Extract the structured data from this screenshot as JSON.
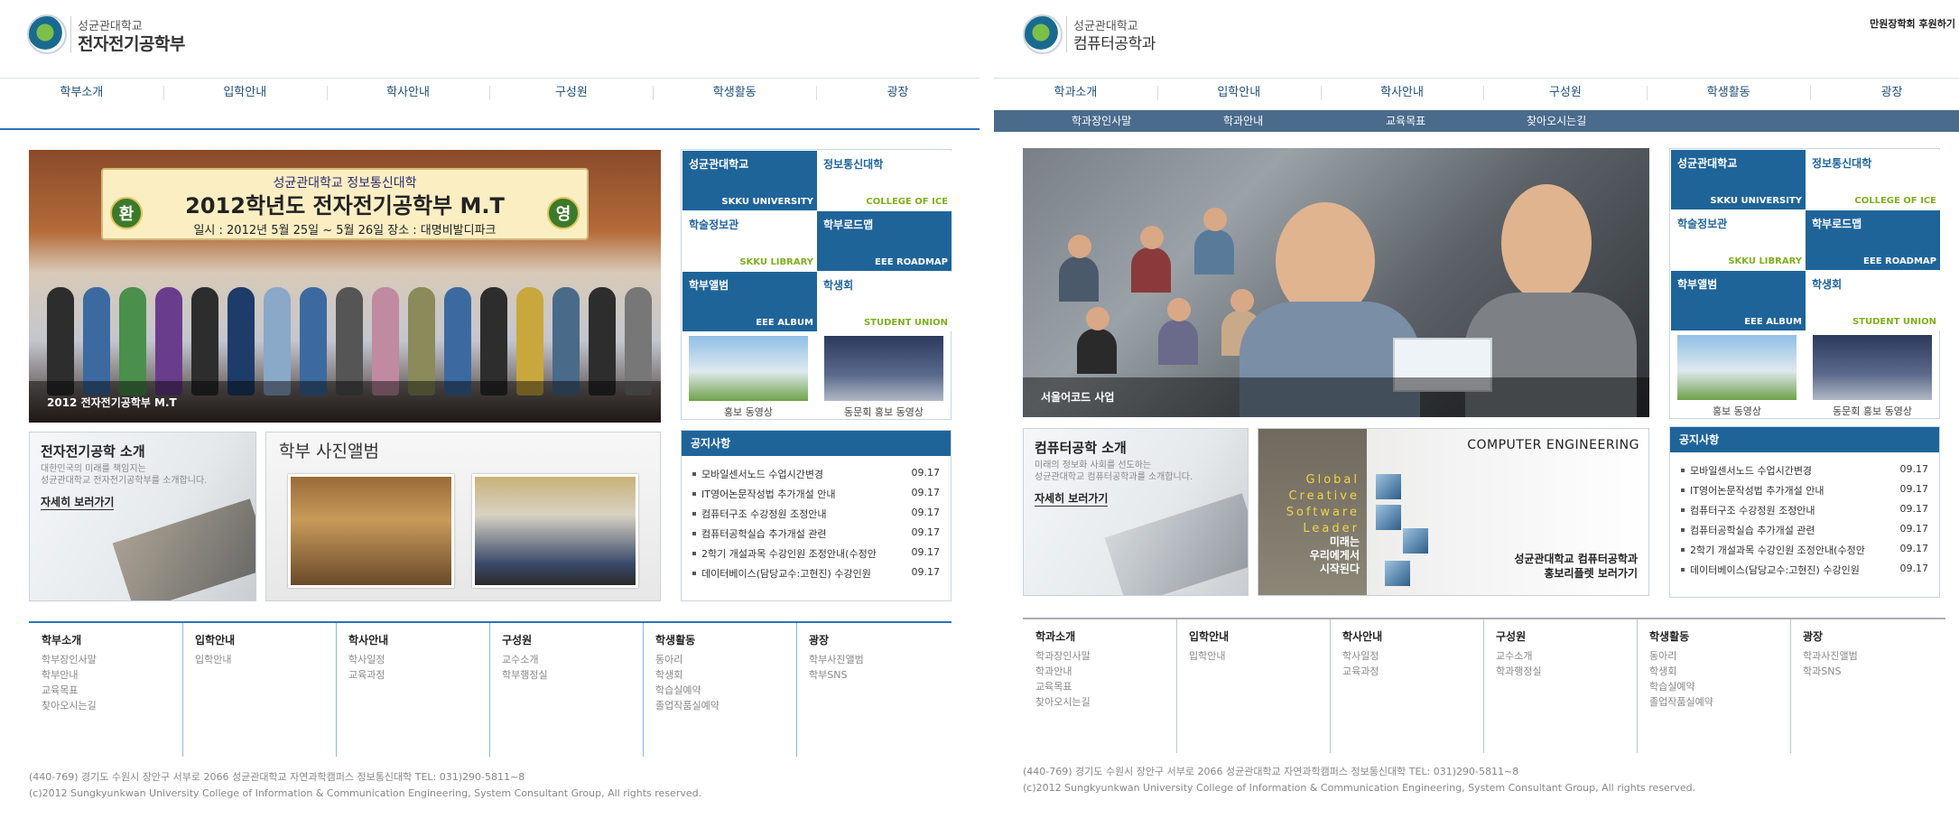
{
  "left": {
    "univ": "성균관대학교",
    "dept": "전자전기공학부",
    "gnb": [
      "학부소개",
      "입학안내",
      "학사안내",
      "구성원",
      "학생활동",
      "광장"
    ],
    "hero": {
      "banner_top": "성균관대학교  정보통신대학",
      "banner_circle_left": "환",
      "banner_main": "2012학년도 전자전기공학부 M.T",
      "banner_circle_right": "영",
      "banner_sub": "일시 : 2012년 5월 25일 ~ 5월 26일    장소 : 대명비발디파크",
      "caption": "2012 전자전기공학부 M.T"
    },
    "quick": [
      {
        "title": "성균관대학교",
        "en": "SKKU UNIVERSITY",
        "style": "dark"
      },
      {
        "title": "정보통신대학",
        "en": "COLLEGE OF ICE",
        "style": "light"
      },
      {
        "title": "학술정보관",
        "en": "SKKU LIBRARY",
        "style": "light"
      },
      {
        "title": "학부로드맵",
        "en": "EEE ROADMAP",
        "style": "dark"
      },
      {
        "title": "학부앨범",
        "en": "EEE ALBUM",
        "style": "dark"
      },
      {
        "title": "학생회",
        "en": "STUDENT UNION",
        "style": "light"
      }
    ],
    "videos": [
      "홍보 동영상",
      "동문회 홍보 동영상"
    ],
    "intro": {
      "title": "전자전기공학 소개",
      "desc1": "대한민국의 미래를 책임지는",
      "desc2": "성균관대학교 전자전기공학부를 소개합니다.",
      "more": "자세히 보러가기"
    },
    "album_title": "학부 사진앨범",
    "notice": {
      "title": "공지사항",
      "rows": [
        {
          "text": "모바일센서노드 수업시간변경",
          "date": "09.17"
        },
        {
          "text": "IT영어논문작성법 추가개설 안내",
          "date": "09.17"
        },
        {
          "text": "컴퓨터구조 수강정원 조정안내",
          "date": "09.17"
        },
        {
          "text": "컴퓨터공학실습 추가개설 관련",
          "date": "09.17"
        },
        {
          "text": "2학기 개설과목 수강인원 조정안내(수정안",
          "date": "09.17"
        },
        {
          "text": "데이터베이스(담당교수:고현진) 수강인원",
          "date": "09.17"
        }
      ]
    },
    "footer_nav": [
      {
        "title": "학부소개",
        "links": [
          "학부장인사말",
          "학부안내",
          "교육목표",
          "찾아오시는길"
        ]
      },
      {
        "title": "입학안내",
        "links": [
          "입학안내"
        ]
      },
      {
        "title": "학사안내",
        "links": [
          "학사일정",
          "교육과정"
        ]
      },
      {
        "title": "구성원",
        "links": [
          "교수소개",
          "학부행정실"
        ]
      },
      {
        "title": "학생활동",
        "links": [
          "동아리",
          "학생회",
          "학습실예약",
          "졸업작품실예약"
        ]
      },
      {
        "title": "광장",
        "links": [
          "학부사진앨범",
          "학부SNS"
        ]
      }
    ],
    "address": "(440-769) 경기도 수원시 장안구 서부로 2066 성균관대학교 자연과학캠퍼스 정보통신대학 TEL: 031)290-5811~8",
    "copyright": "(c)2012 Sungkyunkwan University College of Information & Communication Engineering, System Consultant Group, All rights reserved."
  },
  "right": {
    "univ": "성균관대학교",
    "dept": "컴퓨터공학과",
    "header_link": "만원장학회 후원하기",
    "gnb": [
      "학과소개",
      "입학안내",
      "학사안내",
      "구성원",
      "학생활동",
      "광장"
    ],
    "subnav": [
      "학과장인사말",
      "학과안내",
      "교육목표",
      "찾아오시는길"
    ],
    "hero_caption": "서울어코드 사업",
    "quick": [
      {
        "title": "성균관대학교",
        "en": "SKKU UNIVERSITY",
        "style": "dark"
      },
      {
        "title": "정보통신대학",
        "en": "COLLEGE OF ICE",
        "style": "light"
      },
      {
        "title": "학술정보관",
        "en": "SKKU LIBRARY",
        "style": "light"
      },
      {
        "title": "학부로드맵",
        "en": "EEE ROADMAP",
        "style": "dark"
      },
      {
        "title": "학부앨범",
        "en": "EEE ALBUM",
        "style": "dark"
      },
      {
        "title": "학생회",
        "en": "STUDENT UNION",
        "style": "light"
      }
    ],
    "videos": [
      "홍보 동영상",
      "동문회 홍보 동영상"
    ],
    "intro": {
      "title": "컴퓨터공학 소개",
      "desc1": "미래의 정보화 사회를 선도하는",
      "desc2": "성균관대학교 컴퓨터공학과를 소개합니다.",
      "more": "자세히 보러가기"
    },
    "ce": {
      "title": "COMPUTER ENGINEERING",
      "words": [
        "Global",
        "Creative",
        "Software",
        "Leader"
      ],
      "sub": [
        "미래는",
        "우리에게서",
        "시작된다"
      ],
      "bottom1": "성균관대학교 컴퓨터공학과",
      "bottom2": "홍보리플렛 보러가기"
    },
    "notice": {
      "title": "공지사항",
      "rows": [
        {
          "text": "모바일센서노드 수업시간변경",
          "date": "09.17"
        },
        {
          "text": "IT영어논문작성법 추가개설 안내",
          "date": "09.17"
        },
        {
          "text": "컴퓨터구조 수강정원 조정안내",
          "date": "09.17"
        },
        {
          "text": "컴퓨터공학실습 추가개설 관련",
          "date": "09.17"
        },
        {
          "text": "2학기 개설과목 수강인원 조정안내(수정안",
          "date": "09.17"
        },
        {
          "text": "데이터베이스(담당교수:고현진) 수강인원",
          "date": "09.17"
        }
      ]
    },
    "footer_nav": [
      {
        "title": "학과소개",
        "links": [
          "학과장인사말",
          "학과안내",
          "교육목표",
          "찾아오시는길"
        ]
      },
      {
        "title": "입학안내",
        "links": [
          "입학안내"
        ]
      },
      {
        "title": "학사안내",
        "links": [
          "학사일정",
          "교육과정"
        ]
      },
      {
        "title": "구성원",
        "links": [
          "교수소개",
          "학과행정실"
        ]
      },
      {
        "title": "학생활동",
        "links": [
          "동아리",
          "학생회",
          "학습실예약",
          "졸업작품실예약"
        ]
      },
      {
        "title": "광장",
        "links": [
          "학과사진앨범",
          "학과SNS"
        ]
      }
    ],
    "address": "(440-769) 경기도 수원시 장안구 서부로 2066 성균관대학교 자연과학캠퍼스 정보통신대학 TEL: 031)290-5811~8",
    "copyright": "(c)2012 Sungkyunkwan University College of Information & Communication Engineering, System Consultant Group, All rights reserved."
  },
  "colors": {
    "primary": "#1f6499",
    "accent_green": "#7fae1f",
    "line_blue": "#2a74b8",
    "subnav": "#4a6b8c"
  }
}
